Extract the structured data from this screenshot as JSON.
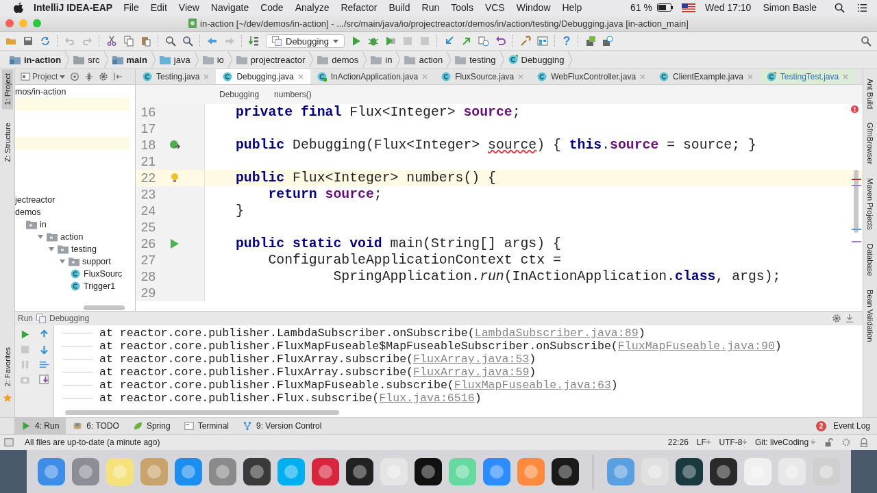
{
  "menu_bar": {
    "app": "IntelliJ IDEA-EAP",
    "menus": [
      "File",
      "Edit",
      "View",
      "Navigate",
      "Code",
      "Analyze",
      "Refactor",
      "Build",
      "Run",
      "Tools",
      "VCS",
      "Window",
      "Help"
    ],
    "battery": "61 %",
    "clock": "Wed 17:10",
    "user": "Simon Basle"
  },
  "window": {
    "title": "in-action [~/dev/demos/in-action] - .../src/main/java/io/projectreactor/demos/in/action/testing/Debugging.java [in-action_main]"
  },
  "toolbar": {
    "run_configuration": "Debugging",
    "help": "?"
  },
  "navigation_bar": [
    {
      "label": "in-action",
      "kind": "module"
    },
    {
      "label": "src",
      "kind": "folder"
    },
    {
      "label": "main",
      "kind": "module"
    },
    {
      "label": "java",
      "kind": "source"
    },
    {
      "label": "io",
      "kind": "package"
    },
    {
      "label": "projectreactor",
      "kind": "package"
    },
    {
      "label": "demos",
      "kind": "package"
    },
    {
      "label": "in",
      "kind": "package"
    },
    {
      "label": "action",
      "kind": "package"
    },
    {
      "label": "testing",
      "kind": "package"
    },
    {
      "label": "Debugging",
      "kind": "class"
    }
  ],
  "left_tool_windows": [
    {
      "label": "1: Project",
      "selected": true
    },
    {
      "label": "Z: Structure",
      "selected": false
    }
  ],
  "favorites": "2: Favorites",
  "project_panel": {
    "title": "Project",
    "tree": [
      {
        "label": "mos/in-action"
      },
      {
        "label": "jectreactor"
      },
      {
        "label": "demos",
        "children": [
          {
            "label": "in",
            "kind": "folder",
            "children": [
              {
                "label": "action",
                "kind": "folder",
                "expanded": true,
                "children": [
                  {
                    "label": "testing",
                    "kind": "folder",
                    "expanded": true,
                    "children": [
                      {
                        "label": "support",
                        "kind": "folder",
                        "expanded": true,
                        "children": [
                          {
                            "label": "FluxSourc",
                            "kind": "class"
                          },
                          {
                            "label": "Trigger1",
                            "kind": "class"
                          }
                        ]
                      }
                    ]
                  }
                ]
              }
            ]
          }
        ]
      }
    ]
  },
  "editor_tabs": [
    {
      "label": "Testing.java",
      "kind": "class",
      "selected": false
    },
    {
      "label": "Debugging.java",
      "kind": "class",
      "selected": true
    },
    {
      "label": "InActionApplication.java",
      "kind": "application",
      "selected": false
    },
    {
      "label": "FluxSource.java",
      "kind": "class",
      "selected": false
    },
    {
      "label": "WebFluxController.java",
      "kind": "class",
      "selected": false
    },
    {
      "label": "ClientExample.java",
      "kind": "class",
      "selected": false
    },
    {
      "label": "TestingTest.java",
      "kind": "test",
      "selected": false
    }
  ],
  "editor": {
    "breadcrumbs": [
      "Debugging",
      "numbers()"
    ],
    "lines": [
      {
        "number": "16",
        "current": false,
        "tokens": [
          {
            "kind": "keyword",
            "text": "private final "
          },
          {
            "kind": "plain",
            "text": "Flux<Integer> "
          },
          {
            "kind": "field",
            "text": "source"
          },
          {
            "kind": "plain",
            "text": ";"
          }
        ]
      },
      {
        "number": "17",
        "current": false
      },
      {
        "number": "18",
        "current": false,
        "kind": "bean",
        "tokens": [
          {
            "kind": "keyword",
            "text": "public "
          },
          {
            "kind": "plain",
            "text": "Debugging(Flux<Integer> "
          },
          {
            "kind": "error",
            "text": "source"
          },
          {
            "kind": "plain",
            "text": ") { "
          },
          {
            "kind": "keyword",
            "text": "this"
          },
          {
            "kind": "plain",
            "text": "."
          },
          {
            "kind": "field",
            "text": "source"
          },
          {
            "kind": "plain",
            "text": " = source; }"
          }
        ]
      },
      {
        "number": "21",
        "current": false
      },
      {
        "number": "22",
        "current": true,
        "kind": "bulb",
        "tokens": [
          {
            "kind": "keyword",
            "text": "public "
          },
          {
            "kind": "plain",
            "text": "Flux<Integer> numbers() {"
          }
        ]
      },
      {
        "number": "23",
        "current": false,
        "tokens": [
          {
            "kind": "keyword",
            "text": "    return "
          },
          {
            "kind": "field",
            "text": "source"
          },
          {
            "kind": "plain",
            "text": ";"
          }
        ]
      },
      {
        "number": "24",
        "current": false,
        "tokens": [
          {
            "kind": "plain",
            "text": "}"
          }
        ]
      },
      {
        "number": "25",
        "current": false
      },
      {
        "number": "26",
        "current": false,
        "kind": "run",
        "tokens": [
          {
            "kind": "keyword",
            "text": "public static void "
          },
          {
            "kind": "plain",
            "text": "main(String[] args) {"
          }
        ]
      },
      {
        "number": "27",
        "current": false,
        "tokens": [
          {
            "kind": "plain",
            "text": "    ConfigurableApplicationContext ctx ="
          }
        ]
      },
      {
        "number": "28",
        "current": false,
        "tokens": [
          {
            "kind": "plain",
            "text": "            SpringApplication."
          },
          {
            "kind": "static",
            "text": "run"
          },
          {
            "kind": "plain",
            "text": "(InActionApplication."
          },
          {
            "kind": "keyword",
            "text": "class"
          },
          {
            "kind": "plain",
            "text": ", args);"
          }
        ]
      },
      {
        "number": "29",
        "current": false
      }
    ]
  },
  "run_panel": {
    "title": "Run",
    "configuration": "Debugging",
    "console": [
      {
        "text": "at reactor.core.publisher.LambdaSubscriber.onSubscribe(",
        "link": "LambdaSubscriber.java:89",
        "end": ")"
      },
      {
        "text": "at reactor.core.publisher.FluxMapFuseable$MapFuseableSubscriber.onSubscribe(",
        "link": "FluxMapFuseable.java:90",
        "end": ")"
      },
      {
        "text": "at reactor.core.publisher.FluxArray.subscribe(",
        "link": "FluxArray.java:53",
        "end": ")"
      },
      {
        "text": "at reactor.core.publisher.FluxArray.subscribe(",
        "link": "FluxArray.java:59",
        "end": ")"
      },
      {
        "text": "at reactor.core.publisher.FluxMapFuseable.subscribe(",
        "link": "FluxMapFuseable.java:63",
        "end": ")"
      },
      {
        "text": "at reactor.core.publisher.Flux.subscribe(",
        "link": "Flux.java:6516",
        "end": ")"
      }
    ]
  },
  "bottom_tabs": [
    {
      "label": "4: Run",
      "kind": "run",
      "selected": true
    },
    {
      "label": "6: TODO",
      "kind": "todo",
      "selected": false
    },
    {
      "label": "Spring",
      "kind": "spring",
      "selected": false
    },
    {
      "label": "Terminal",
      "kind": "terminal",
      "selected": false
    },
    {
      "label": "9: Version Control",
      "kind": "vcs",
      "selected": false
    }
  ],
  "event_log": {
    "label": "Event Log",
    "count": "2"
  },
  "status_bar": {
    "message": "All files are up-to-date (a minute ago)",
    "position": "22:26",
    "line_separator": "LF÷",
    "encoding": "UTF-8÷",
    "branch": "Git: liveCoding ÷"
  },
  "right_tool_windows": [
    "Ant Build",
    "GfmBrowser",
    "Maven Projects",
    "Database",
    "Bean Validation"
  ]
}
